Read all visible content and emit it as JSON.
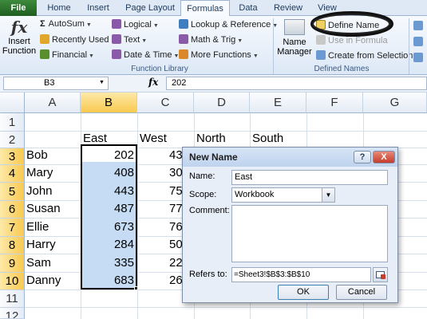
{
  "tabs": [
    {
      "label": "File"
    },
    {
      "label": "Home"
    },
    {
      "label": "Insert"
    },
    {
      "label": "Page Layout"
    },
    {
      "label": "Formulas"
    },
    {
      "label": "Data"
    },
    {
      "label": "Review"
    },
    {
      "label": "View"
    }
  ],
  "ribbon": {
    "insert_function": "Insert Function",
    "insert_function_line1": "Insert",
    "insert_function_line2": "Function",
    "autosum": "AutoSum",
    "recently_used": "Recently Used",
    "financial": "Financial",
    "logical": "Logical",
    "text": "Text",
    "date_time": "Date & Time",
    "lookup_reference": "Lookup & Reference",
    "math_trig": "Math & Trig",
    "more_functions": "More Functions",
    "function_library": "Function Library",
    "name_manager_line1": "Name",
    "name_manager_line2": "Manager",
    "define_name": "Define Name",
    "use_in_formula": "Use in Formula",
    "create_from_selection": "Create from Selection",
    "defined_names": "Defined Names"
  },
  "formula_bar": {
    "name_box": "B3",
    "fx": "fx",
    "value": "202"
  },
  "columns": [
    "A",
    "B",
    "C",
    "D",
    "E",
    "F",
    "G"
  ],
  "rows": [
    "1",
    "2",
    "3",
    "4",
    "5",
    "6",
    "7",
    "8",
    "9",
    "10",
    "11",
    "12"
  ],
  "sheet": {
    "headers": {
      "b": "East",
      "c": "West",
      "d": "North",
      "e": "South"
    },
    "names": [
      "Bob",
      "Mary",
      "John",
      "Susan",
      "Ellie",
      "Harry",
      "Sam",
      "Danny"
    ],
    "east": [
      "202",
      "408",
      "443",
      "487",
      "673",
      "284",
      "335",
      "683"
    ],
    "west_partial": [
      "43",
      "30",
      "75",
      "77",
      "76",
      "50",
      "22",
      "26"
    ]
  },
  "dialog": {
    "title": "New Name",
    "help": "?",
    "close": "X",
    "name_label": "Name:",
    "name_value": "East",
    "scope_label": "Scope:",
    "scope_value": "Workbook",
    "comment_label": "Comment:",
    "refers_label": "Refers to:",
    "refers_value": "=Sheet3!$B$3:$B$10",
    "ok": "OK",
    "cancel": "Cancel"
  }
}
